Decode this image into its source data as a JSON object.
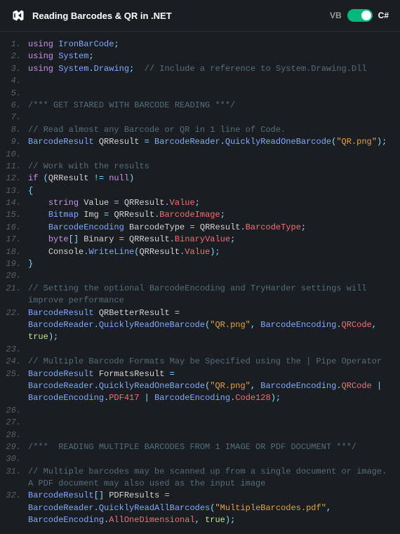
{
  "header": {
    "title": "Reading Barcodes & QR in .NET",
    "lang_vb": "VB",
    "lang_cs": "C#"
  },
  "lines": [
    {
      "n": "1",
      "segs": [
        {
          "c": "kw",
          "t": "using"
        },
        {
          "c": "",
          "t": " "
        },
        {
          "c": "ns",
          "t": "IronBarCode"
        },
        {
          "c": "punct",
          "t": ";"
        }
      ]
    },
    {
      "n": "2",
      "segs": [
        {
          "c": "kw",
          "t": "using"
        },
        {
          "c": "",
          "t": " "
        },
        {
          "c": "ns",
          "t": "System"
        },
        {
          "c": "punct",
          "t": ";"
        }
      ]
    },
    {
      "n": "3",
      "segs": [
        {
          "c": "kw",
          "t": "using"
        },
        {
          "c": "",
          "t": " "
        },
        {
          "c": "ns",
          "t": "System"
        },
        {
          "c": "punct",
          "t": "."
        },
        {
          "c": "ns",
          "t": "Drawing"
        },
        {
          "c": "punct",
          "t": ";"
        },
        {
          "c": "",
          "t": "  "
        },
        {
          "c": "cm",
          "t": "// Include a reference to System.Drawing.Dll"
        }
      ]
    },
    {
      "n": "4",
      "segs": []
    },
    {
      "n": "5",
      "segs": []
    },
    {
      "n": "6",
      "segs": [
        {
          "c": "cm",
          "t": "/*** GET STARED WITH BARCODE READING ***/"
        }
      ]
    },
    {
      "n": "7",
      "segs": []
    },
    {
      "n": "8",
      "segs": [
        {
          "c": "cm",
          "t": "// Read almost any Barcode or QR in 1 line of Code."
        }
      ]
    },
    {
      "n": "9",
      "segs": [
        {
          "c": "type",
          "t": "BarcodeResult"
        },
        {
          "c": "",
          "t": " QRResult "
        },
        {
          "c": "punct",
          "t": "="
        },
        {
          "c": "",
          "t": " "
        },
        {
          "c": "type",
          "t": "BarcodeReader"
        },
        {
          "c": "punct",
          "t": "."
        },
        {
          "c": "method",
          "t": "QuicklyReadOneBarcode"
        },
        {
          "c": "punct",
          "t": "("
        },
        {
          "c": "str",
          "t": "\"QR.png\""
        },
        {
          "c": "punct",
          "t": ");"
        }
      ]
    },
    {
      "n": "10",
      "segs": []
    },
    {
      "n": "11",
      "segs": [
        {
          "c": "cm",
          "t": "// Work with the results"
        }
      ]
    },
    {
      "n": "12",
      "segs": [
        {
          "c": "kw",
          "t": "if"
        },
        {
          "c": "",
          "t": " "
        },
        {
          "c": "punct",
          "t": "("
        },
        {
          "c": "",
          "t": "QRResult "
        },
        {
          "c": "punct",
          "t": "!="
        },
        {
          "c": "",
          "t": " "
        },
        {
          "c": "kw",
          "t": "null"
        },
        {
          "c": "punct",
          "t": ")"
        }
      ]
    },
    {
      "n": "13",
      "segs": [
        {
          "c": "punct",
          "t": "{"
        }
      ]
    },
    {
      "n": "14",
      "segs": [
        {
          "c": "",
          "t": "    "
        },
        {
          "c": "kw",
          "t": "string"
        },
        {
          "c": "",
          "t": " Value "
        },
        {
          "c": "punct",
          "t": "="
        },
        {
          "c": "",
          "t": " QRResult"
        },
        {
          "c": "punct",
          "t": "."
        },
        {
          "c": "prop",
          "t": "Value"
        },
        {
          "c": "punct",
          "t": ";"
        }
      ]
    },
    {
      "n": "15",
      "segs": [
        {
          "c": "",
          "t": "    "
        },
        {
          "c": "type",
          "t": "Bitmap"
        },
        {
          "c": "",
          "t": " Img "
        },
        {
          "c": "punct",
          "t": "="
        },
        {
          "c": "",
          "t": " QRResult"
        },
        {
          "c": "punct",
          "t": "."
        },
        {
          "c": "prop",
          "t": "BarcodeImage"
        },
        {
          "c": "punct",
          "t": ";"
        }
      ]
    },
    {
      "n": "16",
      "segs": [
        {
          "c": "",
          "t": "    "
        },
        {
          "c": "type",
          "t": "BarcodeEncoding"
        },
        {
          "c": "",
          "t": " BarcodeType "
        },
        {
          "c": "punct",
          "t": "="
        },
        {
          "c": "",
          "t": " QRResult"
        },
        {
          "c": "punct",
          "t": "."
        },
        {
          "c": "prop",
          "t": "BarcodeType"
        },
        {
          "c": "punct",
          "t": ";"
        }
      ]
    },
    {
      "n": "17",
      "segs": [
        {
          "c": "",
          "t": "    "
        },
        {
          "c": "kw",
          "t": "byte"
        },
        {
          "c": "punct",
          "t": "[]"
        },
        {
          "c": "",
          "t": " Binary "
        },
        {
          "c": "punct",
          "t": "="
        },
        {
          "c": "",
          "t": " QRResult"
        },
        {
          "c": "punct",
          "t": "."
        },
        {
          "c": "prop",
          "t": "BinaryValue"
        },
        {
          "c": "punct",
          "t": ";"
        }
      ]
    },
    {
      "n": "18",
      "segs": [
        {
          "c": "",
          "t": "    Console"
        },
        {
          "c": "punct",
          "t": "."
        },
        {
          "c": "method",
          "t": "WriteLine"
        },
        {
          "c": "punct",
          "t": "("
        },
        {
          "c": "",
          "t": "QRResult"
        },
        {
          "c": "punct",
          "t": "."
        },
        {
          "c": "prop",
          "t": "Value"
        },
        {
          "c": "punct",
          "t": ");"
        }
      ]
    },
    {
      "n": "19",
      "segs": [
        {
          "c": "punct",
          "t": "}"
        }
      ]
    },
    {
      "n": "20",
      "segs": []
    },
    {
      "n": "21",
      "segs": [
        {
          "c": "cm",
          "t": "// Setting the optional BarcodeEncoding and TryHarder settings will improve performance"
        }
      ]
    },
    {
      "n": "22",
      "segs": [
        {
          "c": "type",
          "t": "BarcodeResult"
        },
        {
          "c": "",
          "t": " QRBetterResult "
        },
        {
          "c": "punct",
          "t": "="
        },
        {
          "c": "",
          "t": " "
        },
        {
          "c": "type",
          "t": "BarcodeReader"
        },
        {
          "c": "punct",
          "t": "."
        },
        {
          "c": "method",
          "t": "QuicklyReadOneBarcode"
        },
        {
          "c": "punct",
          "t": "("
        },
        {
          "c": "str",
          "t": "\"QR.png\""
        },
        {
          "c": "punct",
          "t": ", "
        },
        {
          "c": "type",
          "t": "BarcodeEncoding"
        },
        {
          "c": "punct",
          "t": "."
        },
        {
          "c": "prop",
          "t": "QRCode"
        },
        {
          "c": "punct",
          "t": ", "
        },
        {
          "c": "bool",
          "t": "true"
        },
        {
          "c": "punct",
          "t": ");"
        }
      ]
    },
    {
      "n": "23",
      "segs": []
    },
    {
      "n": "24",
      "segs": [
        {
          "c": "cm",
          "t": "// Multiple Barcode Formats May be Specified using the | Pipe Operator"
        }
      ]
    },
    {
      "n": "25",
      "segs": [
        {
          "c": "type",
          "t": "BarcodeResult"
        },
        {
          "c": "",
          "t": " FormatsResult "
        },
        {
          "c": "punct",
          "t": "="
        },
        {
          "c": "",
          "t": " "
        },
        {
          "c": "type",
          "t": "BarcodeReader"
        },
        {
          "c": "punct",
          "t": "."
        },
        {
          "c": "method",
          "t": "QuicklyReadOneBarcode"
        },
        {
          "c": "punct",
          "t": "("
        },
        {
          "c": "str",
          "t": "\"QR.png\""
        },
        {
          "c": "punct",
          "t": ", "
        },
        {
          "c": "type",
          "t": "BarcodeEncoding"
        },
        {
          "c": "punct",
          "t": "."
        },
        {
          "c": "prop",
          "t": "QRCode"
        },
        {
          "c": "",
          "t": " "
        },
        {
          "c": "punct",
          "t": "|"
        },
        {
          "c": "",
          "t": " "
        },
        {
          "c": "type",
          "t": "BarcodeEncoding"
        },
        {
          "c": "punct",
          "t": "."
        },
        {
          "c": "prop",
          "t": "PDF417"
        },
        {
          "c": "",
          "t": " "
        },
        {
          "c": "punct",
          "t": "|"
        },
        {
          "c": "",
          "t": " "
        },
        {
          "c": "type",
          "t": "BarcodeEncoding"
        },
        {
          "c": "punct",
          "t": "."
        },
        {
          "c": "prop",
          "t": "Code128"
        },
        {
          "c": "punct",
          "t": ");"
        }
      ]
    },
    {
      "n": "26",
      "segs": []
    },
    {
      "n": "27",
      "segs": []
    },
    {
      "n": "28",
      "segs": []
    },
    {
      "n": "29",
      "segs": [
        {
          "c": "cm",
          "t": "/***  READING MULTIPLE BARCODES FROM 1 IMAGE OR PDF DOCUMENT ***/"
        }
      ]
    },
    {
      "n": "30",
      "segs": []
    },
    {
      "n": "31",
      "segs": [
        {
          "c": "cm",
          "t": "// Multiple barcodes may be scanned up from a single document or image.  A PDF document may also used as the input image"
        }
      ]
    },
    {
      "n": "32",
      "segs": [
        {
          "c": "type",
          "t": "BarcodeResult"
        },
        {
          "c": "punct",
          "t": "[]"
        },
        {
          "c": "",
          "t": " PDFResults "
        },
        {
          "c": "punct",
          "t": "="
        },
        {
          "c": "",
          "t": " "
        },
        {
          "c": "type",
          "t": "BarcodeReader"
        },
        {
          "c": "punct",
          "t": "."
        },
        {
          "c": "method",
          "t": "QuicklyReadAllBarcodes"
        },
        {
          "c": "punct",
          "t": "("
        },
        {
          "c": "str",
          "t": "\"MultipleBarcodes.pdf\""
        },
        {
          "c": "punct",
          "t": ", "
        },
        {
          "c": "type",
          "t": "BarcodeEncoding"
        },
        {
          "c": "punct",
          "t": "."
        },
        {
          "c": "prop",
          "t": "AllOneDimensional"
        },
        {
          "c": "punct",
          "t": ", "
        },
        {
          "c": "bool",
          "t": "true"
        },
        {
          "c": "punct",
          "t": ");"
        }
      ]
    }
  ]
}
